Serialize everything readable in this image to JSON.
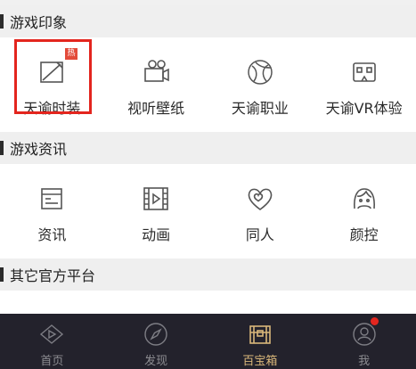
{
  "sections": [
    {
      "title": "游戏印象",
      "items": [
        "天谕时装",
        "视听壁纸",
        "天谕职业",
        "天谕VR体验"
      ]
    },
    {
      "title": "游戏资讯",
      "items": [
        "资讯",
        "动画",
        "同人",
        "颜控"
      ]
    },
    {
      "title": "其它官方平台"
    }
  ],
  "badge": {
    "hot": "热"
  },
  "tabbar": {
    "items": [
      "首页",
      "发现",
      "百宝箱",
      "我"
    ],
    "active": "百宝箱"
  },
  "colors": {
    "highlight": "#e3251e",
    "tabbar_bg": "#23222c",
    "tab_active": "#d9b77a",
    "notify_dot": "#e3261f"
  }
}
